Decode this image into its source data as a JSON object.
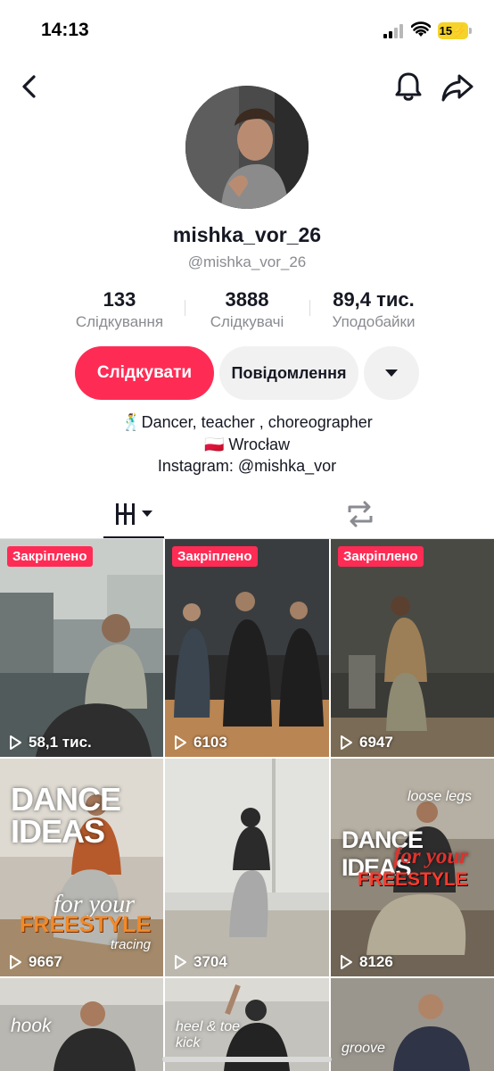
{
  "status_bar": {
    "time": "14:13",
    "battery": "15"
  },
  "profile": {
    "username": "mishka_vor_26",
    "handle": "@mishka_vor_26"
  },
  "stats": [
    {
      "value": "133",
      "label": "Слідкування"
    },
    {
      "value": "3888",
      "label": "Слідкувачі"
    },
    {
      "value": "89,4 тис.",
      "label": "Уподобайки"
    }
  ],
  "actions": {
    "follow": "Слідкувати",
    "message": "Повідомлення"
  },
  "bio": {
    "line1": "🕺Dancer, teacher , choreographer",
    "line2": "🇵🇱 Wrocław",
    "line3": "Instagram: @mishka_vor"
  },
  "videos": [
    {
      "pinned": "Закріплено",
      "views": "58,1 тис."
    },
    {
      "pinned": "Закріплено",
      "views": "6103"
    },
    {
      "pinned": "Закріплено",
      "views": "6947"
    },
    {
      "views": "9667",
      "text_top": "DANCE IDEAS",
      "text_mid": "for your",
      "text_bottom": "FREESTYLE",
      "caption": "tracing"
    },
    {
      "views": "3704"
    },
    {
      "views": "8126",
      "caption_top": "loose legs",
      "text_top": "DANCE IDEAS",
      "text_mid": "for your",
      "text_bottom": "FREESTYLE"
    },
    {
      "caption": "hook"
    },
    {
      "caption": "heel & toe",
      "caption2": "kick"
    },
    {
      "caption": "groove"
    }
  ],
  "colors": {
    "accent": "#fe2c55",
    "pinned_badge": "#fe2c55",
    "secondary_button": "#f1f1f2",
    "muted_text": "#8a8b91",
    "battery": "#f5d32a"
  }
}
